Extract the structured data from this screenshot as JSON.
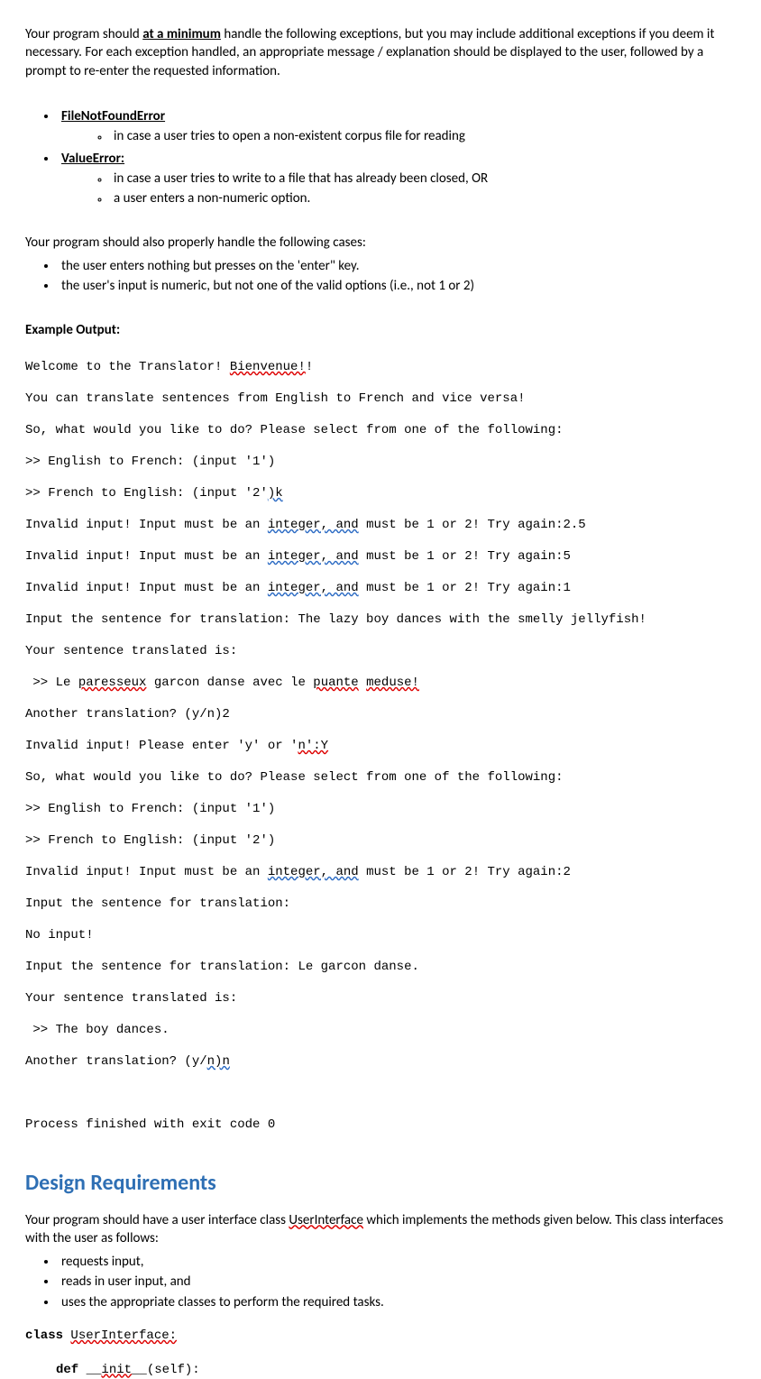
{
  "intro": {
    "l1_pre": "Your program should ",
    "l1_bu": "at a minimum",
    "l1_post": " handle the following exceptions, but you may include additional exceptions if you deem it necessary. For each exception handled, an appropriate message / explanation should be displayed to the user, followed by a prompt to re-enter the requested information."
  },
  "exc": {
    "file": "FileNotFoundError",
    "file_sub1": "in case a user tries to open a non-existent corpus file for reading",
    "value": "ValueError:",
    "value_sub1": "in case a user tries to write to a file that has already been closed, OR",
    "value_sub2": "a user enters a non-numeric option."
  },
  "handle": {
    "lead": "Your program should also properly handle the following cases:",
    "i1": "the user enters nothing but presses on the 'enter\" key.",
    "i2": "the user's input is numeric, but not one of the valid options (i.e., not 1 or 2)"
  },
  "example_label": "Example Output:",
  "out": {
    "l1_a": "Welcome to the Translator! ",
    "l1_b": "Bienvenue!",
    "l1_c": "!",
    "l2": "You can translate sentences from English to French and vice versa!",
    "l3": "So, what would you like to do? Please select from one of the following:",
    "l4": ">> English to French: (input '1')",
    "l5_a": ">> French to English: (input '2'",
    "l5_b": ")k",
    "l6_a": "Invalid input! Input must be an ",
    "l6_b": "integer, and",
    "l6_c": " must be 1 or 2! Try again:2.5",
    "l7_a": "Invalid input! Input must be an ",
    "l7_b": "integer, and",
    "l7_c": " must be 1 or 2! Try again:5",
    "l8_a": "Invalid input! Input must be an ",
    "l8_b": "integer, and",
    "l8_c": " must be 1 or 2! Try again:1",
    "l9": "Input the sentence for translation: The lazy boy dances with the smelly jellyfish!",
    "l10": "Your sentence translated is:",
    "l11_a": " >> Le ",
    "l11_b": "paresseux",
    "l11_c": " garcon danse avec le ",
    "l11_d": "puante",
    "l11_e": " ",
    "l11_f": "meduse!",
    "l12": "Another translation? (y/n)2",
    "l13_a": "Invalid input! Please enter 'y' or '",
    "l13_b": "n':Y",
    "l14": "So, what would you like to do? Please select from one of the following:",
    "l15": ">> English to French: (input '1')",
    "l16": ">> French to English: (input '2')",
    "l17_a": "Invalid input! Input must be an ",
    "l17_b": "integer, and",
    "l17_c": " must be 1 or 2! Try again:2",
    "l18": "Input the sentence for translation:",
    "l19": "No input!",
    "l20": "Input the sentence for translation: Le garcon danse.",
    "l21": "Your sentence translated is:",
    "l22": " >> The boy dances.",
    "l23_a": "Another translation? (y/",
    "l23_b": "n)n",
    "blank": "",
    "l24": "Process finished with exit code 0"
  },
  "design_heading": "Design Requirements",
  "design": {
    "p_a": "Your program should have a user interface class ",
    "p_b": "UserInterface",
    "p_c": " which implements the methods given below. This class interfaces with the user as follows:",
    "d1": "requests input,",
    "d2": "reads in user input, and",
    "d3": "uses the appropriate classes to perform the required tasks."
  },
  "code": {
    "class_kw": "class ",
    "class_name": "UserInterface:",
    "def_kw": "def ",
    "init_u": "__",
    "init_name": "init",
    "init_u2": "__",
    "init_rest": "(self):"
  }
}
